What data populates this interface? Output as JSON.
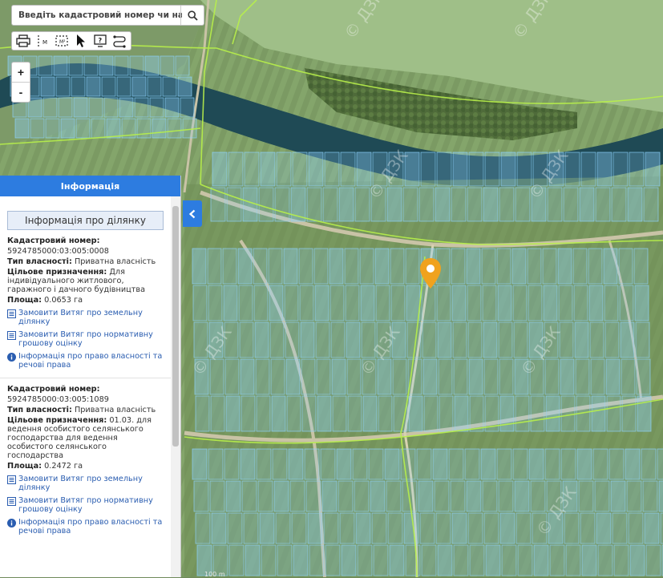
{
  "search": {
    "placeholder": "Введіть кадастровий номер чи населе"
  },
  "toolbar": {
    "icons": [
      "print-icon",
      "measure-length-icon",
      "measure-area-icon",
      "select-cursor-icon",
      "info-screen-icon",
      "route-icon"
    ]
  },
  "zoom": {
    "in_label": "+",
    "out_label": "-"
  },
  "panel": {
    "header": "Інформація",
    "subtitle": "Інформація про ділянку",
    "collapse_icon": "chevron-left-icon"
  },
  "parcels": [
    {
      "cadastral_label": "Кадастровий номер:",
      "cadastral_number": "5924785000:03:005:0008",
      "ownership_label": "Тип власності:",
      "ownership_value": "Приватна власність",
      "purpose_label": "Цільове призначення:",
      "purpose_value": "Для індивідуального житлового, гаражного і дачного будівництва",
      "area_label": "Площа:",
      "area_value": "0.0653 га",
      "link_extract": "Замовити Витяг про земельну ділянку",
      "link_valuation": "Замовити Витяг про нормативну грошову оцінку",
      "link_rights": "Інформація про право власності та речові права"
    },
    {
      "cadastral_label": "Кадастровий номер:",
      "cadastral_number": "5924785000:03:005:1089",
      "ownership_label": "Тип власності:",
      "ownership_value": "Приватна власність",
      "purpose_label": "Цільове призначення:",
      "purpose_value": "01.03. для ведення особистого селянського господарства для ведення особистого селянського господарства",
      "area_label": "Площа:",
      "area_value": "0.2472 га",
      "link_extract": "Замовити Витяг про земельну ділянку",
      "link_valuation": "Замовити Витяг про нормативну грошову оцінку",
      "link_rights": "Інформація про право власності та речові права"
    }
  ],
  "map": {
    "watermark": "© ДЗК",
    "scale_label": "100 m",
    "marker_color": "#f0a21e",
    "parcel_color": "#8fd3ff",
    "boundary_color": "#b8f04a",
    "river_color": "#1f4a55"
  }
}
